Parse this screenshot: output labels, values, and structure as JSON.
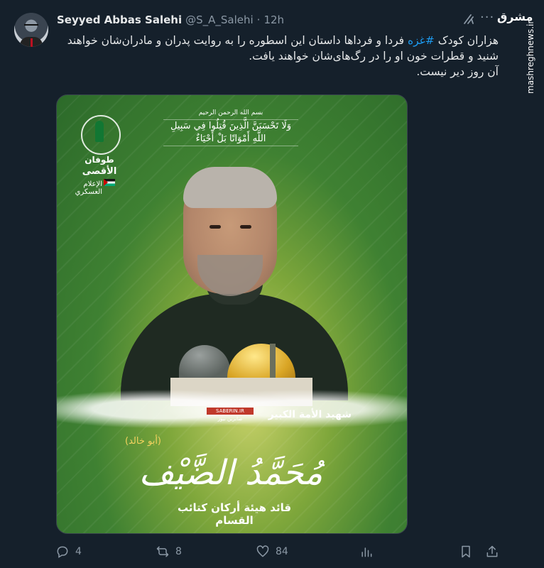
{
  "tweet": {
    "author_name": "Seyyed Abbas Salehi",
    "handle": "@S_A_Salehi",
    "separator": "·",
    "time": "12h",
    "text_before_hashtag": "هزاران کودک ",
    "hashtag": "#غزه",
    "text_after_hashtag": " فردا و فرداها داستان این اسطوره را به روایت پدران و مادران‌شان خواهند شنید و قطرات خون او را در رگ‌های‌شان خواهند یافت.",
    "text_line3": "آن روز دیر نیست.",
    "more_label": "···"
  },
  "watermark": {
    "logo_text": "مشرق",
    "url": "mashreghnews.ir"
  },
  "poster": {
    "basmala": "بسم الله الرحمن الرحيم",
    "verse": "وَلَا تَحْسَبَنَّ الَّذِينَ قُتِلُوا فِي سَبِيلِ اللَّهِ أَمْوَاتًا بَلْ أَحْيَاءٌ",
    "logo_line1": "طوفان",
    "logo_line2": "الأقصى",
    "logo_line3": "الإعلام العسكري",
    "stamp": "SABERIN.IR",
    "stamp_sub": "صابرين نيوز",
    "martyr_title": "شهيد الأمة الكبير",
    "kunya": "(أبو خالد)",
    "name": "مُحَمَّدُ الضَّيْف",
    "subtitle": "قائد هيئة أركان كتائب القسام"
  },
  "actions": {
    "reply_count": "4",
    "retweet_count": "8",
    "like_count": "84",
    "reply_icon": "reply-icon",
    "retweet_icon": "retweet-icon",
    "like_icon": "heart-icon",
    "views_icon": "views-icon",
    "bookmark_icon": "bookmark-icon",
    "share_icon": "share-icon"
  },
  "colors": {
    "background": "#15202b",
    "text": "#e7e9ea",
    "muted": "#8b98a5",
    "hashtag": "#1d9bf0"
  }
}
